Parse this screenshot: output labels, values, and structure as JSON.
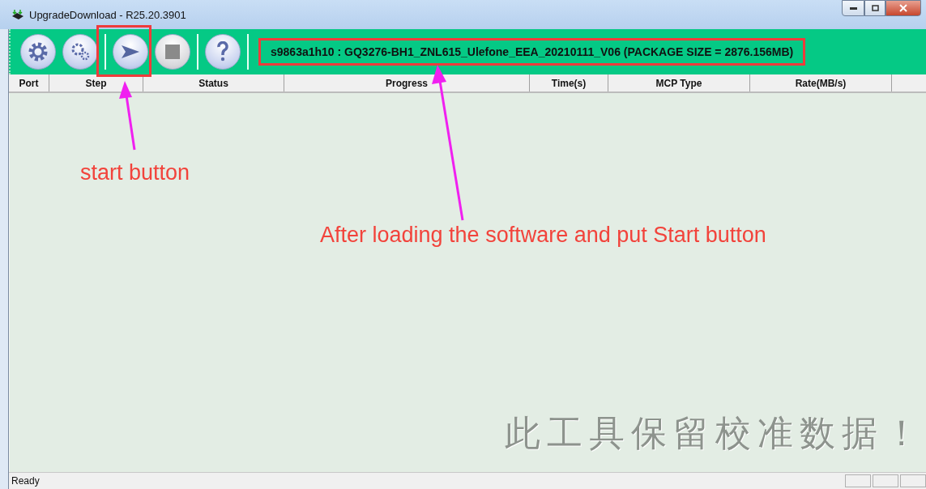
{
  "window": {
    "title": "UpgradeDownload - R25.20.3901"
  },
  "toolbar": {
    "buttons": [
      {
        "kind": "settings",
        "disabled": false
      },
      {
        "kind": "advanced",
        "disabled": false
      },
      {
        "kind": "start",
        "disabled": false
      },
      {
        "kind": "stop",
        "disabled": true
      },
      {
        "kind": "help",
        "disabled": false
      }
    ],
    "package_label": "s9863a1h10 : GQ3276-BH1_ZNL615_Ulefone_EEA_20210111_V06 (PACKAGE SIZE = 2876.156MB)"
  },
  "table": {
    "columns": [
      "Port",
      "Step",
      "Status",
      "Progress",
      "Time(s)",
      "MCP Type",
      "Rate(MB/s)"
    ]
  },
  "background_note": "此工具保留校准数据！",
  "status_bar": {
    "text": "Ready"
  },
  "annotations": [
    {
      "kind": "start",
      "text": "start button"
    },
    {
      "kind": "package",
      "text": "After loading the software and put Start button"
    }
  ]
}
